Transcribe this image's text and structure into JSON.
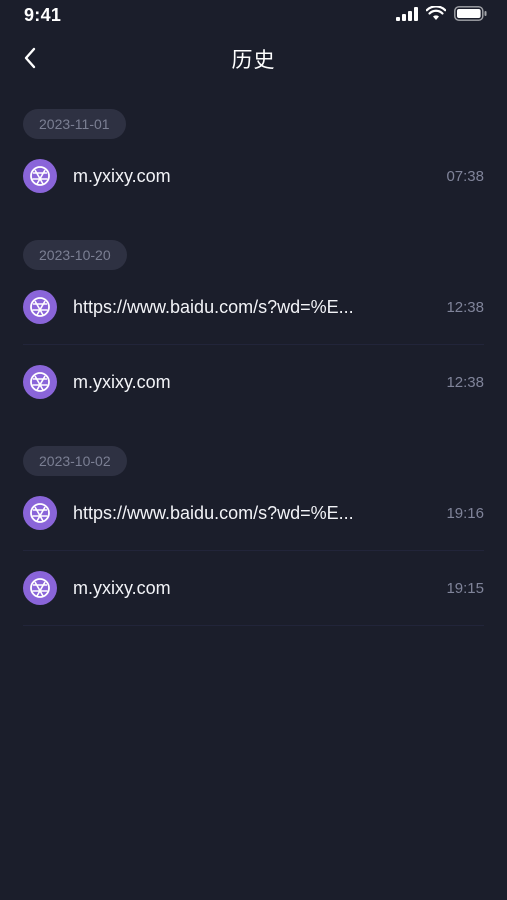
{
  "status_bar": {
    "time": "9:41"
  },
  "header": {
    "title": "历史"
  },
  "groups": [
    {
      "date": "2023-11-01",
      "items": [
        {
          "title": "m.yxixy.com",
          "time": "07:38"
        }
      ]
    },
    {
      "date": "2023-10-20",
      "items": [
        {
          "title": "https://www.baidu.com/s?wd=%E...",
          "time": "12:38"
        },
        {
          "title": "m.yxixy.com",
          "time": "12:38"
        }
      ]
    },
    {
      "date": "2023-10-02",
      "items": [
        {
          "title": "https://www.baidu.com/s?wd=%E...",
          "time": "19:16"
        },
        {
          "title": "m.yxixy.com",
          "time": "19:15"
        }
      ]
    }
  ],
  "colors": {
    "background": "#1b1e2b",
    "accent": "#8a65d9",
    "chip": "#2e3142"
  },
  "icons": {
    "back": "chevron-left-icon",
    "site": "globe-icon"
  }
}
